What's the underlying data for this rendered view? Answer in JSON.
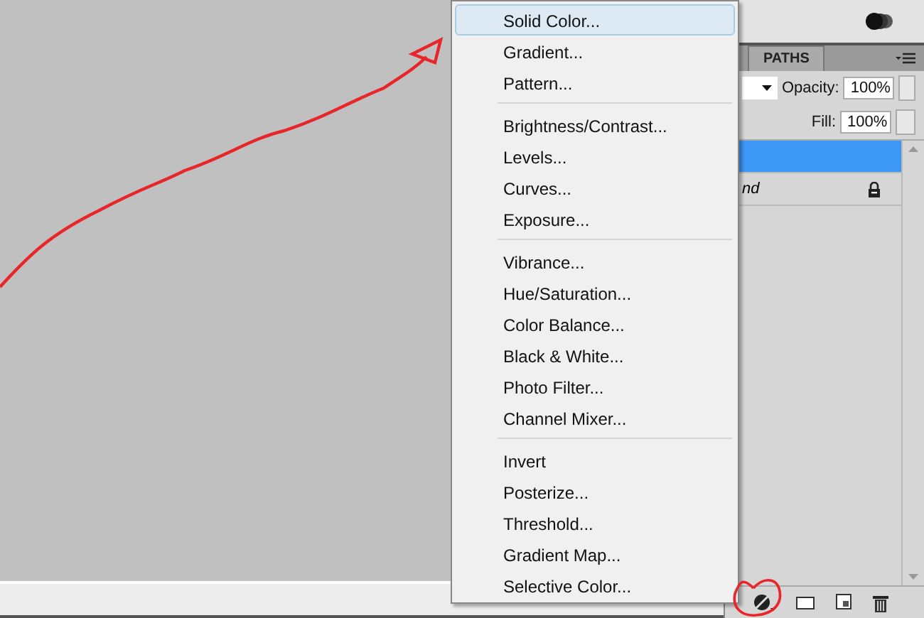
{
  "menu": {
    "groups": [
      {
        "items": [
          {
            "label": "Solid Color...",
            "selected": true
          },
          {
            "label": "Gradient...",
            "selected": false
          },
          {
            "label": "Pattern...",
            "selected": false
          }
        ]
      },
      {
        "items": [
          {
            "label": "Brightness/Contrast...",
            "selected": false
          },
          {
            "label": "Levels...",
            "selected": false
          },
          {
            "label": "Curves...",
            "selected": false
          },
          {
            "label": "Exposure...",
            "selected": false
          }
        ]
      },
      {
        "items": [
          {
            "label": "Vibrance...",
            "selected": false
          },
          {
            "label": "Hue/Saturation...",
            "selected": false
          },
          {
            "label": "Color Balance...",
            "selected": false
          },
          {
            "label": "Black & White...",
            "selected": false
          },
          {
            "label": "Photo Filter...",
            "selected": false
          },
          {
            "label": "Channel Mixer...",
            "selected": false
          }
        ]
      },
      {
        "items": [
          {
            "label": "Invert",
            "selected": false
          },
          {
            "label": "Posterize...",
            "selected": false
          },
          {
            "label": "Threshold...",
            "selected": false
          },
          {
            "label": "Gradient Map...",
            "selected": false
          },
          {
            "label": "Selective Color...",
            "selected": false
          }
        ]
      }
    ]
  },
  "panel": {
    "tabs": [
      {
        "label": "PATHS",
        "selected": false
      }
    ],
    "opacity": {
      "label": "Opacity:",
      "value": "100%"
    },
    "fill": {
      "label": "Fill:",
      "value": "100%"
    },
    "layers": [
      {
        "selected": true,
        "locked": false
      },
      {
        "name": "nd",
        "selected": false,
        "locked": true
      }
    ]
  }
}
